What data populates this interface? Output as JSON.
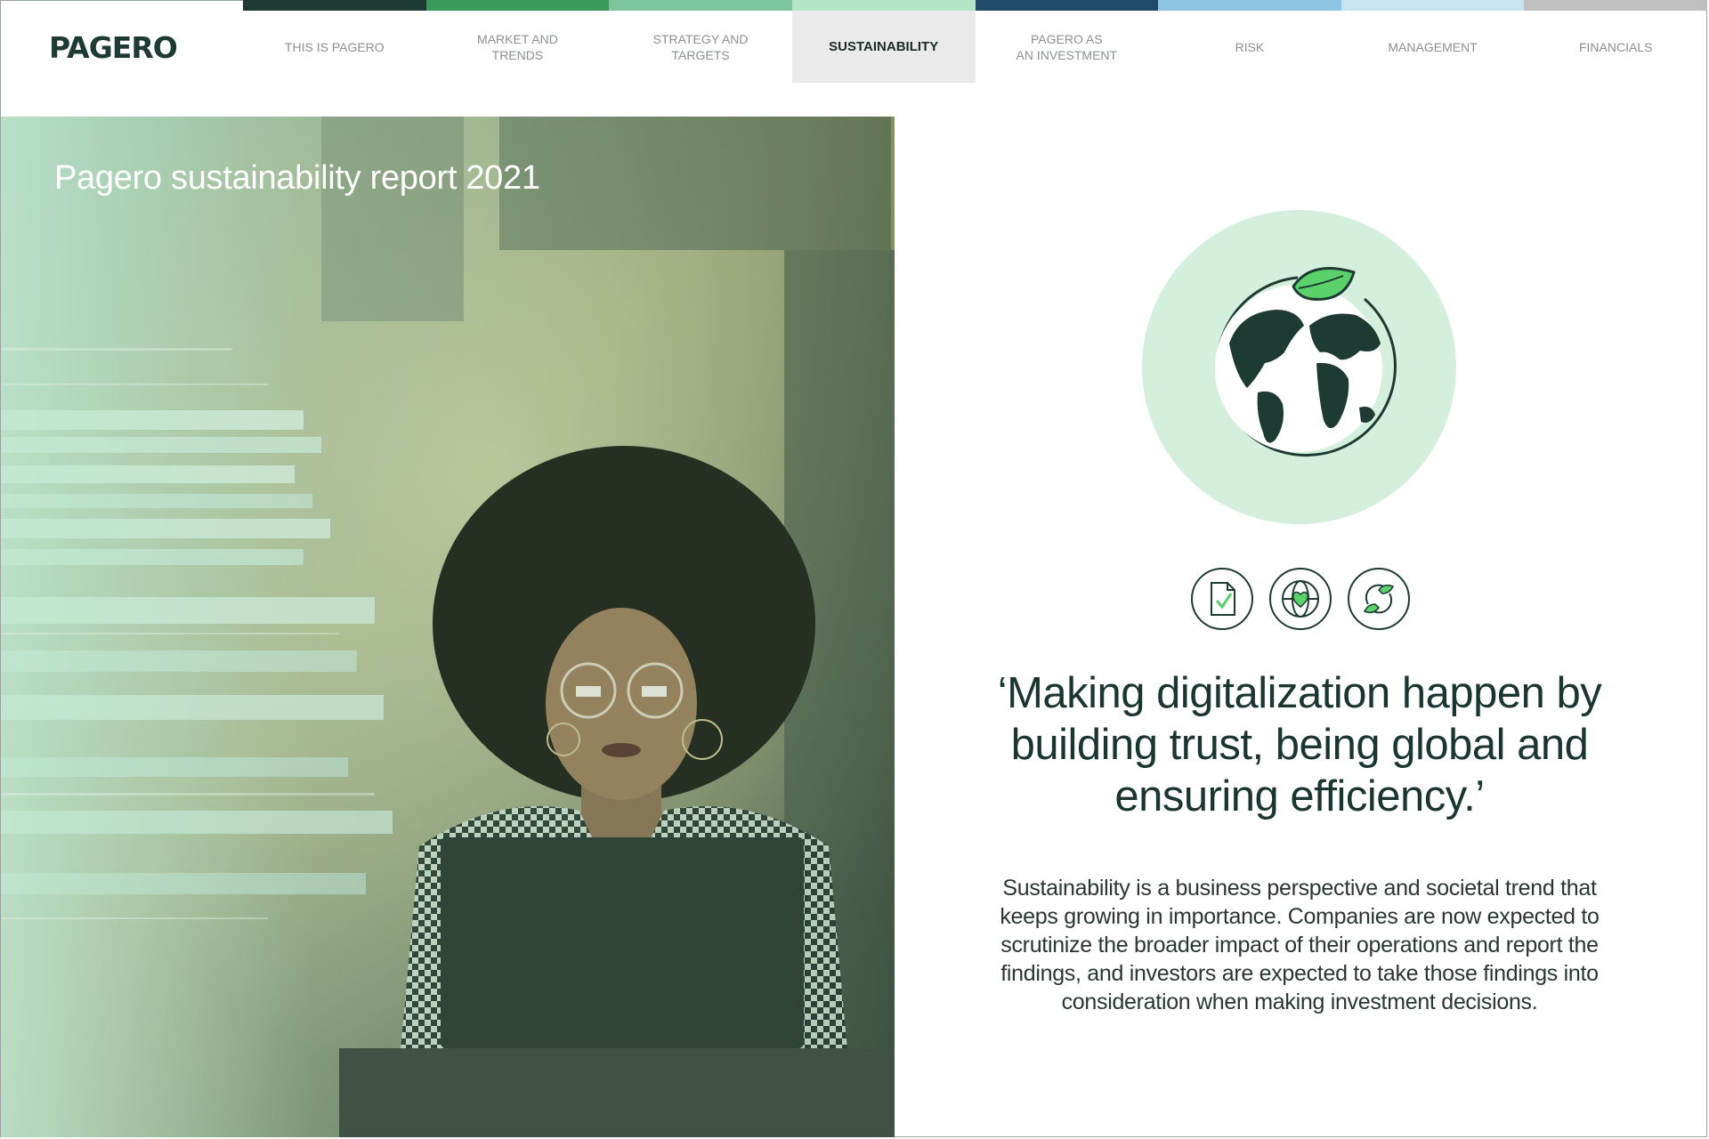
{
  "brand": {
    "logo_text": "PAGERO"
  },
  "nav": {
    "items": [
      {
        "label": "THIS IS PAGERO",
        "color": "#1d3a33",
        "active": false
      },
      {
        "label": "MARKET AND\nTRENDS",
        "color": "#3a9a5c",
        "active": false
      },
      {
        "label": "STRATEGY AND\nTARGETS",
        "color": "#7cc59a",
        "active": false
      },
      {
        "label": "SUSTAINABILITY",
        "color": "#b5e6c4",
        "active": true
      },
      {
        "label": "PAGERO AS\nAN INVESTMENT",
        "color": "#1f4a68",
        "active": false
      },
      {
        "label": "RISK",
        "color": "#8ec4e4",
        "active": false
      },
      {
        "label": "MANAGEMENT",
        "color": "#c7e3f2",
        "active": false
      },
      {
        "label": "FINANCIALS",
        "color": "#bfbfbf",
        "active": false
      }
    ]
  },
  "hero": {
    "title": "Pagero sustainability report 2021"
  },
  "icons": {
    "main": "globe-with-leaf-icon",
    "row": [
      "document-check-icon",
      "globe-heart-icon",
      "leaf-cycle-icon"
    ]
  },
  "content": {
    "quote": "‘Making digitalization happen by building trust, being global and ensuring efficiency.’",
    "body": "Sustainability is a business perspective and societal trend that keeps growing in importance. Companies are now expected to scrutinize the broader impact of their operations and report the findings, and investors are expected to take those findings into consideration when making investment decisions."
  },
  "colors": {
    "brand_dark": "#1d3a33",
    "accent_green": "#5bd16b",
    "circle_bg": "#d4f0dc"
  }
}
